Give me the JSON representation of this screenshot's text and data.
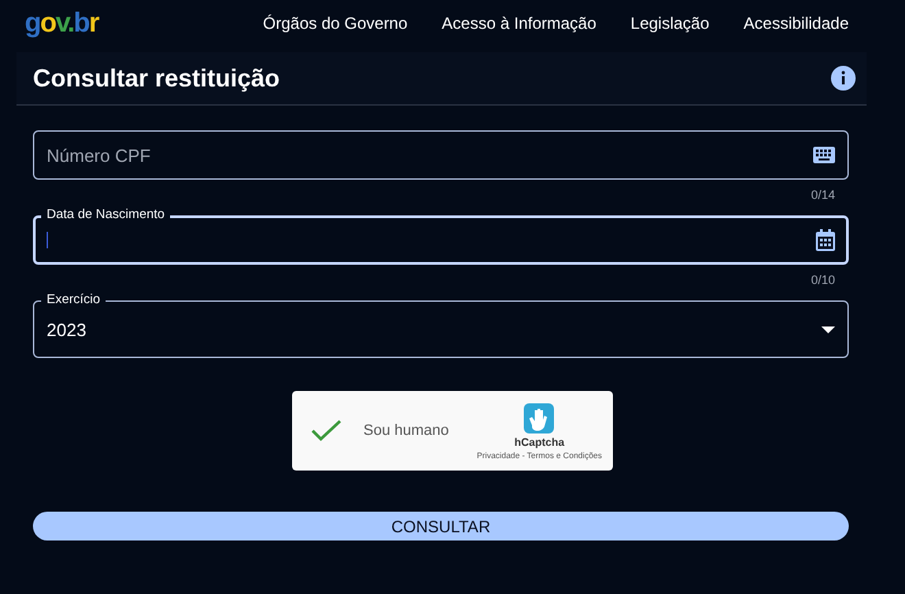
{
  "logo": "gov.br",
  "nav": [
    "Órgãos do Governo",
    "Acesso à Informação",
    "Legislação",
    "Acessibilidade"
  ],
  "page_title": "Consultar restituição",
  "fields": [
    {
      "kind": "text",
      "placeholder": "Número CPF",
      "counter": "0/14",
      "focused": false
    },
    {
      "kind": "date",
      "label": "Data de Nascimento",
      "counter": "0/10",
      "focused": true
    },
    {
      "kind": "select",
      "label": "Exercício",
      "value": "2023",
      "focused": false
    }
  ],
  "captcha": {
    "label": "Sou humano",
    "checked": true,
    "brand": "hCaptcha",
    "links": "Privacidade - Termos e Condições"
  },
  "submit": "CONSULTAR"
}
